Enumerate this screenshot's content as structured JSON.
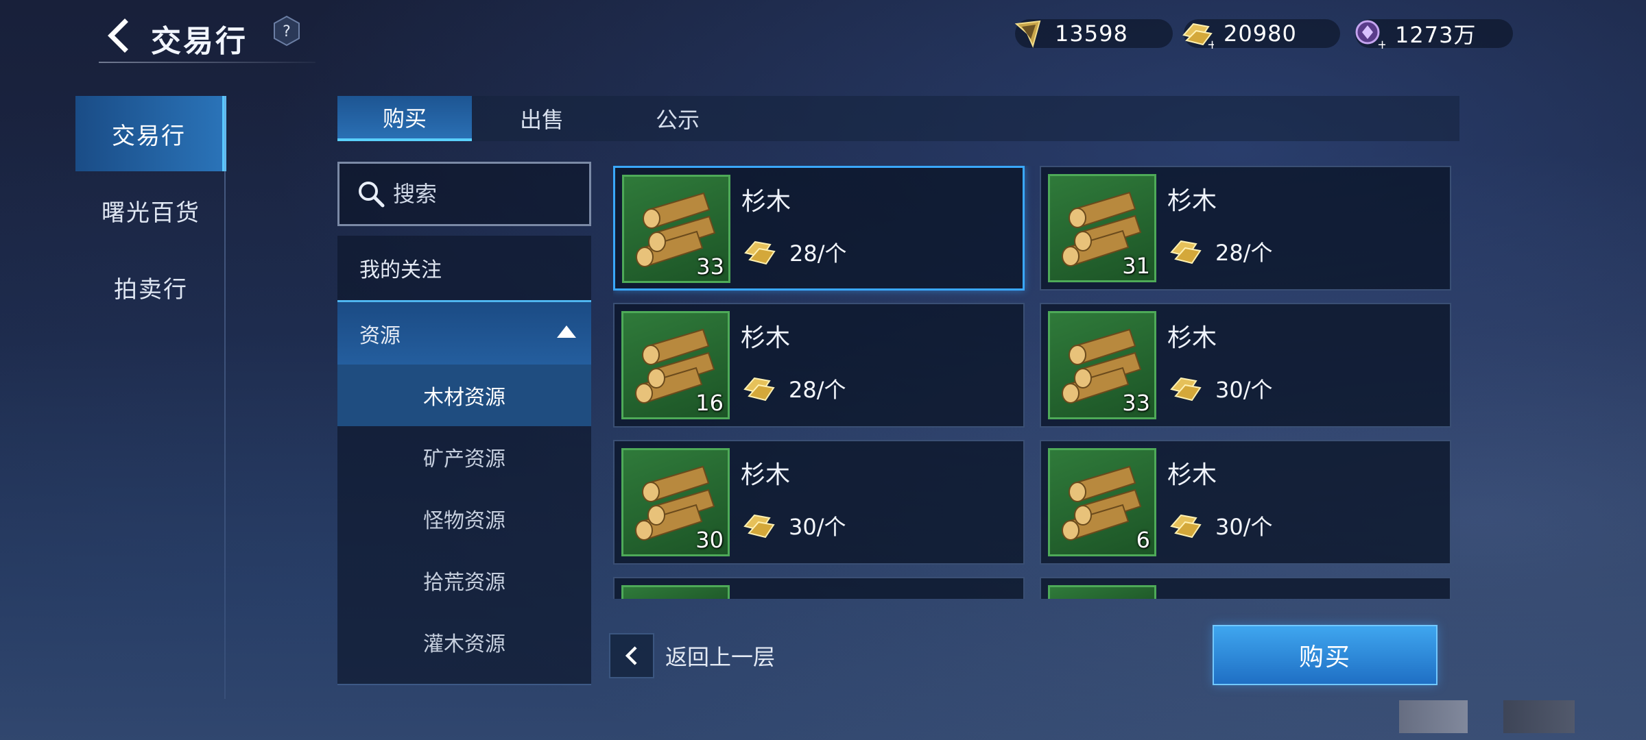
{
  "header": {
    "title": "交易行",
    "help_symbol": "?"
  },
  "currencies": [
    {
      "icon": "ticket-icon",
      "value": "13598"
    },
    {
      "icon": "gold-bar-add-icon",
      "value": "20980"
    },
    {
      "icon": "crystal-add-icon",
      "value": "1273万"
    }
  ],
  "left_nav": [
    {
      "label": "交易行",
      "active": true
    },
    {
      "label": "曙光百货",
      "active": false
    },
    {
      "label": "拍卖行",
      "active": false
    }
  ],
  "tabs": [
    {
      "label": "购买",
      "active": true
    },
    {
      "label": "出售",
      "active": false
    },
    {
      "label": "公示",
      "active": false
    }
  ],
  "search": {
    "placeholder": "搜索"
  },
  "categories": {
    "follow": "我的关注",
    "resource": "资源",
    "sub_items": [
      {
        "label": "木材资源",
        "active": true
      },
      {
        "label": "矿产资源",
        "active": false
      },
      {
        "label": "怪物资源",
        "active": false
      },
      {
        "label": "拾荒资源",
        "active": false
      },
      {
        "label": "灌木资源",
        "active": false
      }
    ]
  },
  "items": [
    {
      "name": "杉木",
      "qty": "33",
      "price": "28/个",
      "selected": true
    },
    {
      "name": "杉木",
      "qty": "31",
      "price": "28/个",
      "selected": false
    },
    {
      "name": "杉木",
      "qty": "16",
      "price": "28/个",
      "selected": false
    },
    {
      "name": "杉木",
      "qty": "33",
      "price": "30/个",
      "selected": false
    },
    {
      "name": "杉木",
      "qty": "30",
      "price": "30/个",
      "selected": false
    },
    {
      "name": "杉木",
      "qty": "6",
      "price": "30/个",
      "selected": false
    }
  ],
  "footer": {
    "back_label": "返回上一层",
    "buy_label": "购买"
  },
  "colors": {
    "accent": "#3aa8ff",
    "active_tab": "#2a6fb4",
    "item_bg": "#2f7a3a"
  }
}
